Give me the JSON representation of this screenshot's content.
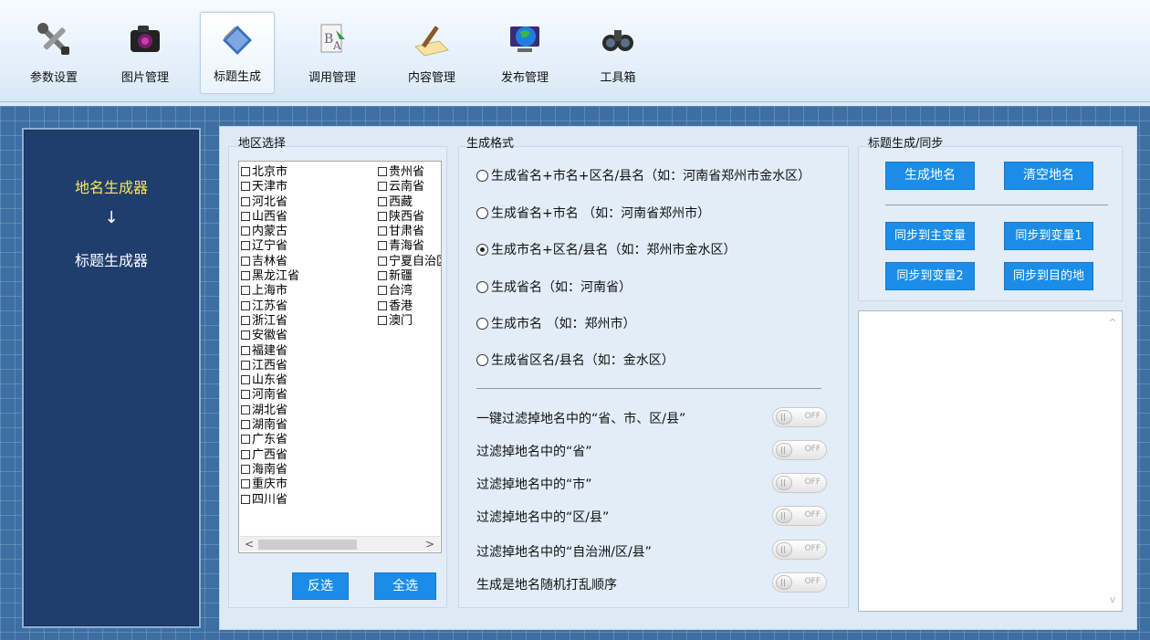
{
  "toolbar": {
    "items": [
      {
        "label": "参数设置",
        "icon": "tools-icon"
      },
      {
        "label": "图片管理",
        "icon": "camera-icon"
      },
      {
        "label": "标题生成",
        "icon": "notebook-icon",
        "active": true
      },
      {
        "label": "调用管理",
        "icon": "text-edit-icon"
      },
      {
        "label": "内容管理",
        "icon": "pen-paper-icon"
      },
      {
        "label": "发布管理",
        "icon": "globe-monitor-icon"
      },
      {
        "label": "工具箱",
        "icon": "binoculars-icon"
      }
    ]
  },
  "leftnav": {
    "item1": "地名生成器",
    "arrow": "↓",
    "item2": "标题生成器"
  },
  "region": {
    "title": "地区选择",
    "col1": [
      "北京市",
      "天津市",
      "河北省",
      "山西省",
      "内蒙古",
      "辽宁省",
      "吉林省",
      "黑龙江省",
      "上海市",
      "江苏省",
      "浙江省",
      "安徽省",
      "福建省",
      "江西省",
      "山东省",
      "河南省",
      "湖北省",
      "湖南省",
      "广东省",
      "广西省",
      "海南省",
      "重庆市",
      "四川省"
    ],
    "col2": [
      "贵州省",
      "云南省",
      "西藏",
      "陕西省",
      "甘肃省",
      "青海省",
      "宁夏自治区",
      "新疆",
      "台湾",
      "香港",
      "澳门"
    ],
    "invert_button": "反选",
    "select_all_button": "全选"
  },
  "format": {
    "title": "生成格式",
    "options": [
      {
        "label": "生成省名+市名+区名/县名（如：河南省郑州市金水区）",
        "selected": false
      },
      {
        "label": "生成省名+市名 （如：河南省郑州市）",
        "selected": false
      },
      {
        "label": "生成市名+区名/县名（如：郑州市金水区）",
        "selected": true
      },
      {
        "label": "生成省名（如：河南省）",
        "selected": false
      },
      {
        "label": "生成市名 （如：郑州市）",
        "selected": false
      },
      {
        "label": "生成省区名/县名（如：金水区）",
        "selected": false
      }
    ],
    "filters": [
      "一键过滤掉地名中的“省、市、区/县”",
      "过滤掉地名中的“省”",
      "过滤掉地名中的“市”",
      "过滤掉地名中的“区/县”",
      "过滤掉地名中的“自治洲/区/县”",
      "生成是地名随机打乱顺序"
    ],
    "toggle_text": "OFF"
  },
  "sync": {
    "title": "标题生成/同步",
    "generate_button": "生成地名",
    "clear_button": "清空地名",
    "sync_main_button": "同步到主变量",
    "sync_var1_button": "同步到变量1",
    "sync_var2_button": "同步到变量2",
    "sync_target_button": "同步到目的地",
    "output_text": ""
  }
}
